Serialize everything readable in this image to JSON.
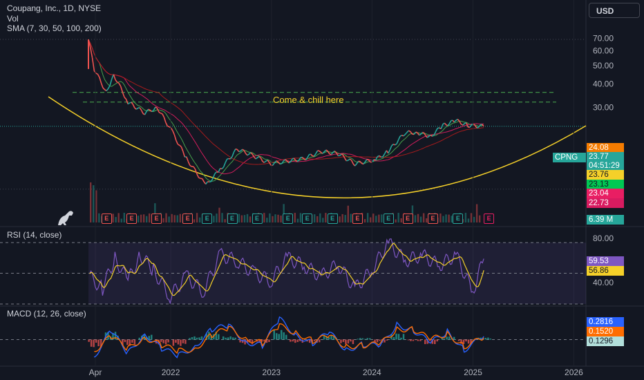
{
  "header": {
    "title_line": "Coupang, Inc., 1D, NYSE",
    "vol_label": "Vol",
    "sma_label": "SMA (7, 30, 50, 100, 200)",
    "currency": "USD"
  },
  "colors": {
    "background": "#131722",
    "up": "#26a69a",
    "down": "#ef5350",
    "cup": "#f5d029",
    "rsi_line": "#7e57c2",
    "rsi_ma": "#f5d029",
    "macd_line": "#2962ff",
    "signal_line": "#ff6d00"
  },
  "annotation": "Come & chill here",
  "price_labels": [
    {
      "text": "24.08",
      "bg": "#f57c00",
      "fg": "#ffffff"
    },
    {
      "text": "CPNG",
      "bg": "#26a69a",
      "fg": "#ffffff"
    },
    {
      "text": "23.77",
      "bg": "#26a69a",
      "fg": "#ffffff"
    },
    {
      "text": "04:51:29",
      "bg": "#26a69a",
      "fg": "#ffffff"
    },
    {
      "text": "23.76",
      "bg": "#f5d029",
      "fg": "#131722"
    },
    {
      "text": "23.13",
      "bg": "#00c853",
      "fg": "#131722"
    },
    {
      "text": "23.04",
      "bg": "#e91e63",
      "fg": "#ffffff"
    },
    {
      "text": "22.73",
      "bg": "#d81b60",
      "fg": "#ffffff"
    },
    {
      "text": "6.39 M",
      "bg": "#26a69a",
      "fg": "#ffffff"
    }
  ],
  "rsi": {
    "title": "RSI (14, close)",
    "labels": [
      {
        "text": "59.53",
        "bg": "#7e57c2",
        "fg": "#ffffff"
      },
      {
        "text": "56.86",
        "bg": "#f5d029",
        "fg": "#131722"
      }
    ]
  },
  "macd": {
    "title": "MACD (12, 26, close)",
    "labels": [
      {
        "text": "0.2816",
        "bg": "#2962ff",
        "fg": "#ffffff"
      },
      {
        "text": "0.1520",
        "bg": "#ff6d00",
        "fg": "#ffffff"
      },
      {
        "text": "0.1296",
        "bg": "#b2dfdb",
        "fg": "#131722"
      }
    ]
  },
  "earnings_markers": [
    {
      "x": "2021-05-12",
      "color": "#ef5350"
    },
    {
      "x": "2021-08-11",
      "color": "#ef5350"
    },
    {
      "x": "2021-11-09",
      "color": "#ef5350"
    },
    {
      "x": "2022-03-02",
      "color": "#ef5350"
    },
    {
      "x": "2022-05-11",
      "color": "#26a69a"
    },
    {
      "x": "2022-08-10",
      "color": "#26a69a"
    },
    {
      "x": "2022-11-08",
      "color": "#26a69a"
    },
    {
      "x": "2023-02-28",
      "color": "#26a69a"
    },
    {
      "x": "2023-05-09",
      "color": "#26a69a"
    },
    {
      "x": "2023-08-08",
      "color": "#26a69a"
    },
    {
      "x": "2023-11-07",
      "color": "#ef5350"
    },
    {
      "x": "2024-02-27",
      "color": "#26a69a"
    },
    {
      "x": "2024-05-07",
      "color": "#ef5350"
    },
    {
      "x": "2024-08-06",
      "color": "#ef5350"
    },
    {
      "x": "2024-11-05",
      "color": "#26a69a"
    },
    {
      "x": "2025-02-25",
      "color": "#e91e63"
    }
  ],
  "chart_data": [
    {
      "type": "line",
      "name": "price",
      "x": [
        "2021-03-11",
        "2021-04-01",
        "2021-05-15",
        "2021-06-10",
        "2021-08-01",
        "2021-10-01",
        "2021-11-15",
        "2022-01-10",
        "2022-03-01",
        "2022-05-10",
        "2022-07-01",
        "2022-09-01",
        "2022-11-01",
        "2023-01-01",
        "2023-03-01",
        "2023-05-01",
        "2023-07-01",
        "2023-09-01",
        "2023-11-01",
        "2024-01-15",
        "2024-03-01",
        "2024-05-01",
        "2024-06-15",
        "2024-08-01",
        "2024-09-15",
        "2024-11-01",
        "2024-12-15",
        "2025-02-10"
      ],
      "values": [
        69.0,
        48.0,
        36.0,
        45.0,
        32.0,
        28.0,
        30.0,
        22.0,
        16.0,
        11.5,
        14.0,
        18.0,
        16.5,
        15.0,
        15.5,
        16.0,
        17.5,
        17.0,
        15.0,
        15.8,
        17.5,
        22.0,
        22.0,
        21.0,
        24.0,
        25.5,
        24.0,
        23.77
      ],
      "ylim": [
        10,
        72
      ],
      "y_ticks": [
        "70.00",
        "60.00",
        "50.00",
        "40.00",
        "30.00"
      ],
      "x_ticks": [
        "Apr",
        "2022",
        "2023",
        "2024",
        "2025",
        "2026"
      ],
      "annotations": [
        "Come & chill here"
      ],
      "horizontal_levels": [
        36.0,
        32.0,
        23.77
      ]
    },
    {
      "type": "line",
      "name": "RSI",
      "x": [
        "2021-03-15",
        "2021-05-01",
        "2021-06-15",
        "2021-08-01",
        "2021-09-15",
        "2021-11-01",
        "2022-01-01",
        "2022-03-01",
        "2022-05-01",
        "2022-07-01",
        "2022-09-01",
        "2022-11-01",
        "2023-01-01",
        "2023-03-01",
        "2023-05-01",
        "2023-07-01",
        "2023-09-01",
        "2023-11-01",
        "2024-01-01",
        "2024-03-01",
        "2024-05-01",
        "2024-07-01",
        "2024-09-01",
        "2024-11-01",
        "2025-01-01",
        "2025-02-10"
      ],
      "values": [
        48,
        40,
        60,
        45,
        62,
        52,
        35,
        48,
        38,
        62,
        58,
        50,
        45,
        60,
        55,
        48,
        56,
        40,
        52,
        70,
        58,
        62,
        55,
        62,
        38,
        59.53
      ],
      "ylim": [
        30,
        75
      ],
      "y_ticks": [
        "80.00",
        "40.00"
      ]
    },
    {
      "type": "bar",
      "name": "MACD",
      "x": [
        "2021-04-01",
        "2021-06-01",
        "2021-08-01",
        "2021-10-01",
        "2021-12-01",
        "2022-02-01",
        "2022-04-01",
        "2022-06-01",
        "2022-08-01",
        "2022-10-01",
        "2022-12-01",
        "2023-02-01",
        "2023-04-01",
        "2023-06-01",
        "2023-08-01",
        "2023-10-01",
        "2023-12-01",
        "2024-02-01",
        "2024-04-01",
        "2024-06-01",
        "2024-08-01",
        "2024-10-01",
        "2024-12-01",
        "2025-02-10"
      ],
      "series": [
        {
          "name": "MACD",
          "values": [
            -1.5,
            0.8,
            -1.2,
            0.5,
            -0.8,
            -1.4,
            -0.6,
            0.9,
            1.2,
            -0.2,
            -0.5,
            1.8,
            0.4,
            -0.3,
            0.6,
            -0.9,
            -0.4,
            -0.6,
            1.3,
            0.8,
            -0.3,
            0.7,
            -0.9,
            0.2816
          ]
        },
        {
          "name": "Signal",
          "values": [
            -1.0,
            0.3,
            -0.8,
            0.2,
            -0.5,
            -1.0,
            -0.8,
            0.4,
            1.0,
            0.1,
            -0.3,
            1.2,
            0.6,
            -0.1,
            0.3,
            -0.6,
            -0.5,
            -0.4,
            0.9,
            0.9,
            0.0,
            0.5,
            -0.6,
            0.152
          ]
        },
        {
          "name": "Histogram",
          "values": [
            -0.5,
            0.5,
            -0.4,
            0.3,
            -0.3,
            -0.4,
            0.2,
            0.5,
            0.2,
            -0.3,
            -0.2,
            0.6,
            -0.2,
            -0.2,
            0.3,
            -0.3,
            0.1,
            -0.2,
            0.4,
            -0.1,
            -0.3,
            0.2,
            -0.3,
            0.1296
          ]
        }
      ],
      "ylim": [
        -2.2,
        2.2
      ]
    }
  ]
}
